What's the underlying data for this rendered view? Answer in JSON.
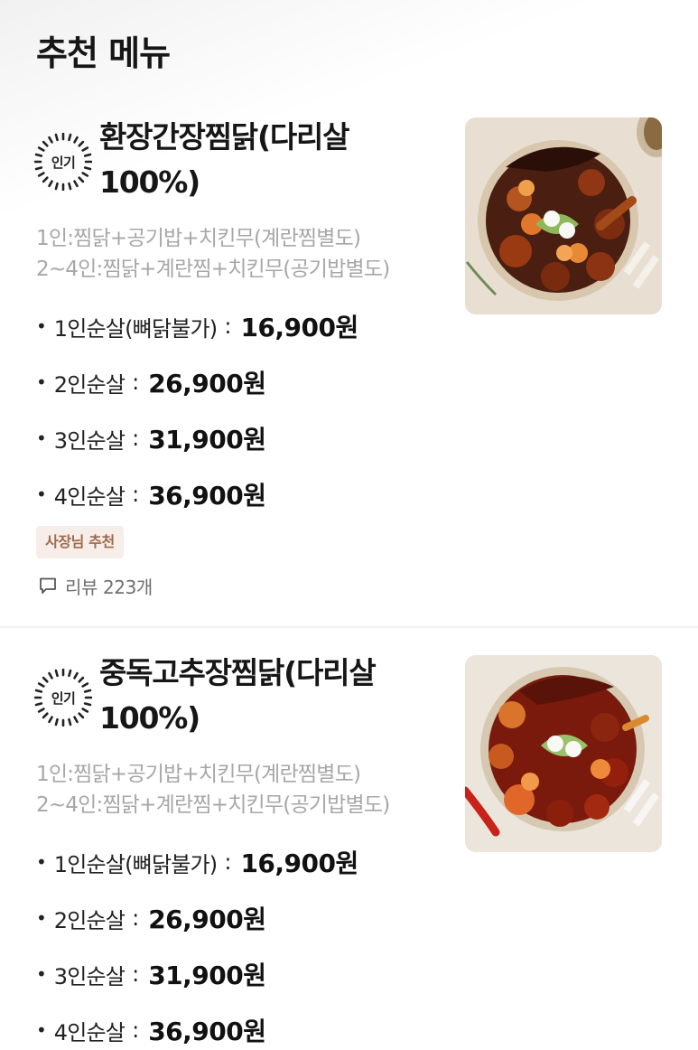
{
  "section": {
    "title": "추천 메뉴"
  },
  "menus": [
    {
      "badge": "인기",
      "name_line1": "환장간장찜닭(다리살",
      "name_line2": "100%)",
      "desc_line1": "1인:찜닭+공기밥+치킨무(계란찜별도)",
      "desc_line2": "2~4인:찜닭+계란찜+치킨무(공기밥별도)",
      "prices": [
        {
          "bullet": "•",
          "label": "1인순살(뼈닭불가)",
          "colon": ":",
          "value": "16,900원"
        },
        {
          "bullet": "•",
          "label": "2인순살",
          "colon": ":",
          "value": "26,900원"
        },
        {
          "bullet": "•",
          "label": "3인순살",
          "colon": ":",
          "value": "31,900원"
        },
        {
          "bullet": "•",
          "label": "4인순살",
          "colon": ":",
          "value": "36,900원"
        }
      ],
      "tag": "사장님 추천",
      "review": "리뷰 223개",
      "image_icon": "braised-chicken-soy-photo"
    },
    {
      "badge": "인기",
      "name_line1": "중독고추장찜닭(다리살",
      "name_line2": "100%)",
      "desc_line1": "1인:찜닭+공기밥+치킨무(계란찜별도)",
      "desc_line2": "2~4인:찜닭+계란찜+치킨무(공기밥별도)",
      "prices": [
        {
          "bullet": "•",
          "label": "1인순살(뼈닭불가)",
          "colon": ":",
          "value": "16,900원"
        },
        {
          "bullet": "•",
          "label": "2인순살",
          "colon": ":",
          "value": "26,900원"
        },
        {
          "bullet": "•",
          "label": "3인순살",
          "colon": ":",
          "value": "31,900원"
        },
        {
          "bullet": "•",
          "label": "4인순살",
          "colon": ":",
          "value": "36,900원"
        }
      ],
      "image_icon": "braised-chicken-gochujang-photo"
    }
  ],
  "colors": {
    "tag_bg": "#f7eee9",
    "tag_text": "#a06a4e",
    "desc_text": "#a7a7a7",
    "sauce_soy": "#4a1e10",
    "sauce_red": "#7a1a0c"
  }
}
